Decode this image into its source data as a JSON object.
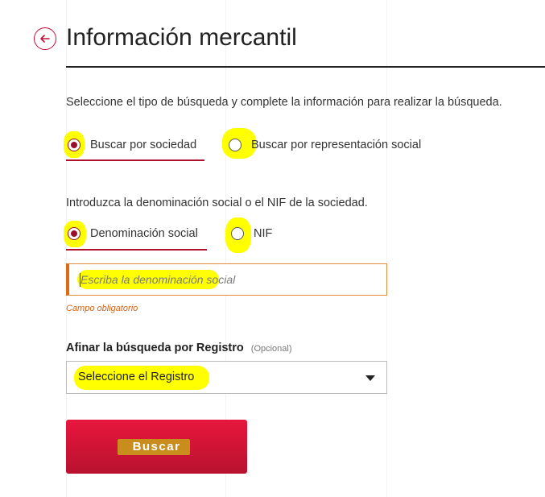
{
  "header": {
    "title": "Información mercantil",
    "back_icon": "arrow-left-circle-icon"
  },
  "search_type": {
    "instruction": "Seleccione el tipo de búsqueda y complete la información para realizar la búsqueda.",
    "options": [
      {
        "label": "Buscar por sociedad",
        "checked": true
      },
      {
        "label": "Buscar por representación social",
        "checked": false
      }
    ]
  },
  "company_field": {
    "instruction": "Introduzca la denominación social o el NIF de la sociedad.",
    "options": [
      {
        "label": "Denominación social",
        "checked": true
      },
      {
        "label": "NIF",
        "checked": false
      }
    ],
    "input_value": "",
    "input_placeholder": "Escriba la denominación social",
    "required_text": "Campo obligatorio"
  },
  "registry": {
    "label": "Afinar la búsqueda por Registro",
    "optional_text": "(Opcional)",
    "selected_value": "Seleccione el Registro"
  },
  "submit": {
    "label": "Buscar"
  },
  "colors": {
    "accent": "#b0122e",
    "button": "#d4153a",
    "highlight": "#ffff00",
    "required": "#d4641a"
  }
}
